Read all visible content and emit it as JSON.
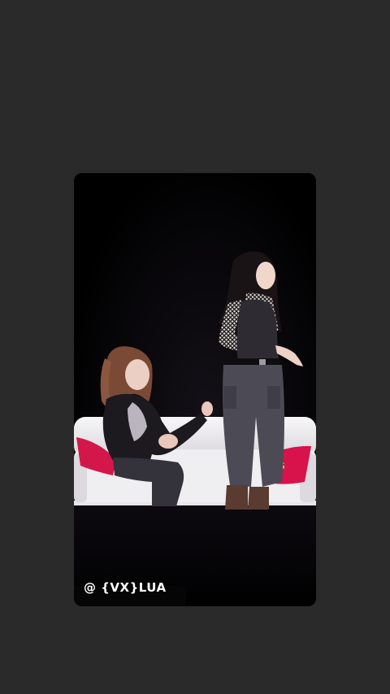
{
  "watermark": "@ {VX}LUA"
}
